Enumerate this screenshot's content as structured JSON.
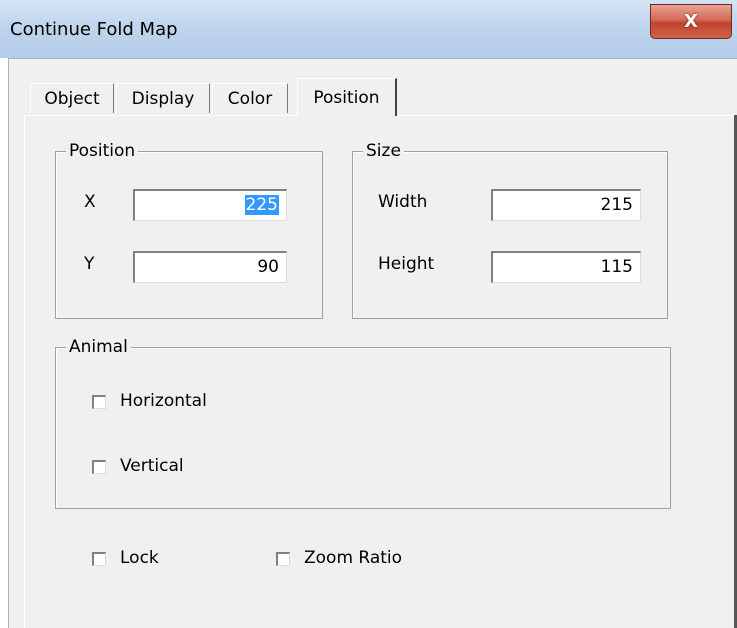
{
  "window": {
    "title": "Continue Fold Map",
    "close_glyph": "X"
  },
  "tabs": [
    {
      "label": "Object",
      "active": false
    },
    {
      "label": "Display",
      "active": false
    },
    {
      "label": "Color",
      "active": false
    },
    {
      "label": "Position",
      "active": true
    }
  ],
  "position_group": {
    "legend": "Position",
    "x_label": "X",
    "x_value": "225",
    "y_label": "Y",
    "y_value": "90"
  },
  "size_group": {
    "legend": "Size",
    "width_label": "Width",
    "width_value": "215",
    "height_label": "Height",
    "height_value": "115"
  },
  "animal_group": {
    "legend": "Animal",
    "horizontal_label": "Horizontal",
    "horizontal_checked": false,
    "vertical_label": "Vertical",
    "vertical_checked": false
  },
  "options": {
    "lock_label": "Lock",
    "lock_checked": false,
    "zoom_label": "Zoom Ratio",
    "zoom_checked": false
  },
  "colors": {
    "title_gradient": "#c0d6ee",
    "close_button": "#c0432c",
    "dialog_bg": "#f0f0f0",
    "selection": "#3399ff"
  }
}
